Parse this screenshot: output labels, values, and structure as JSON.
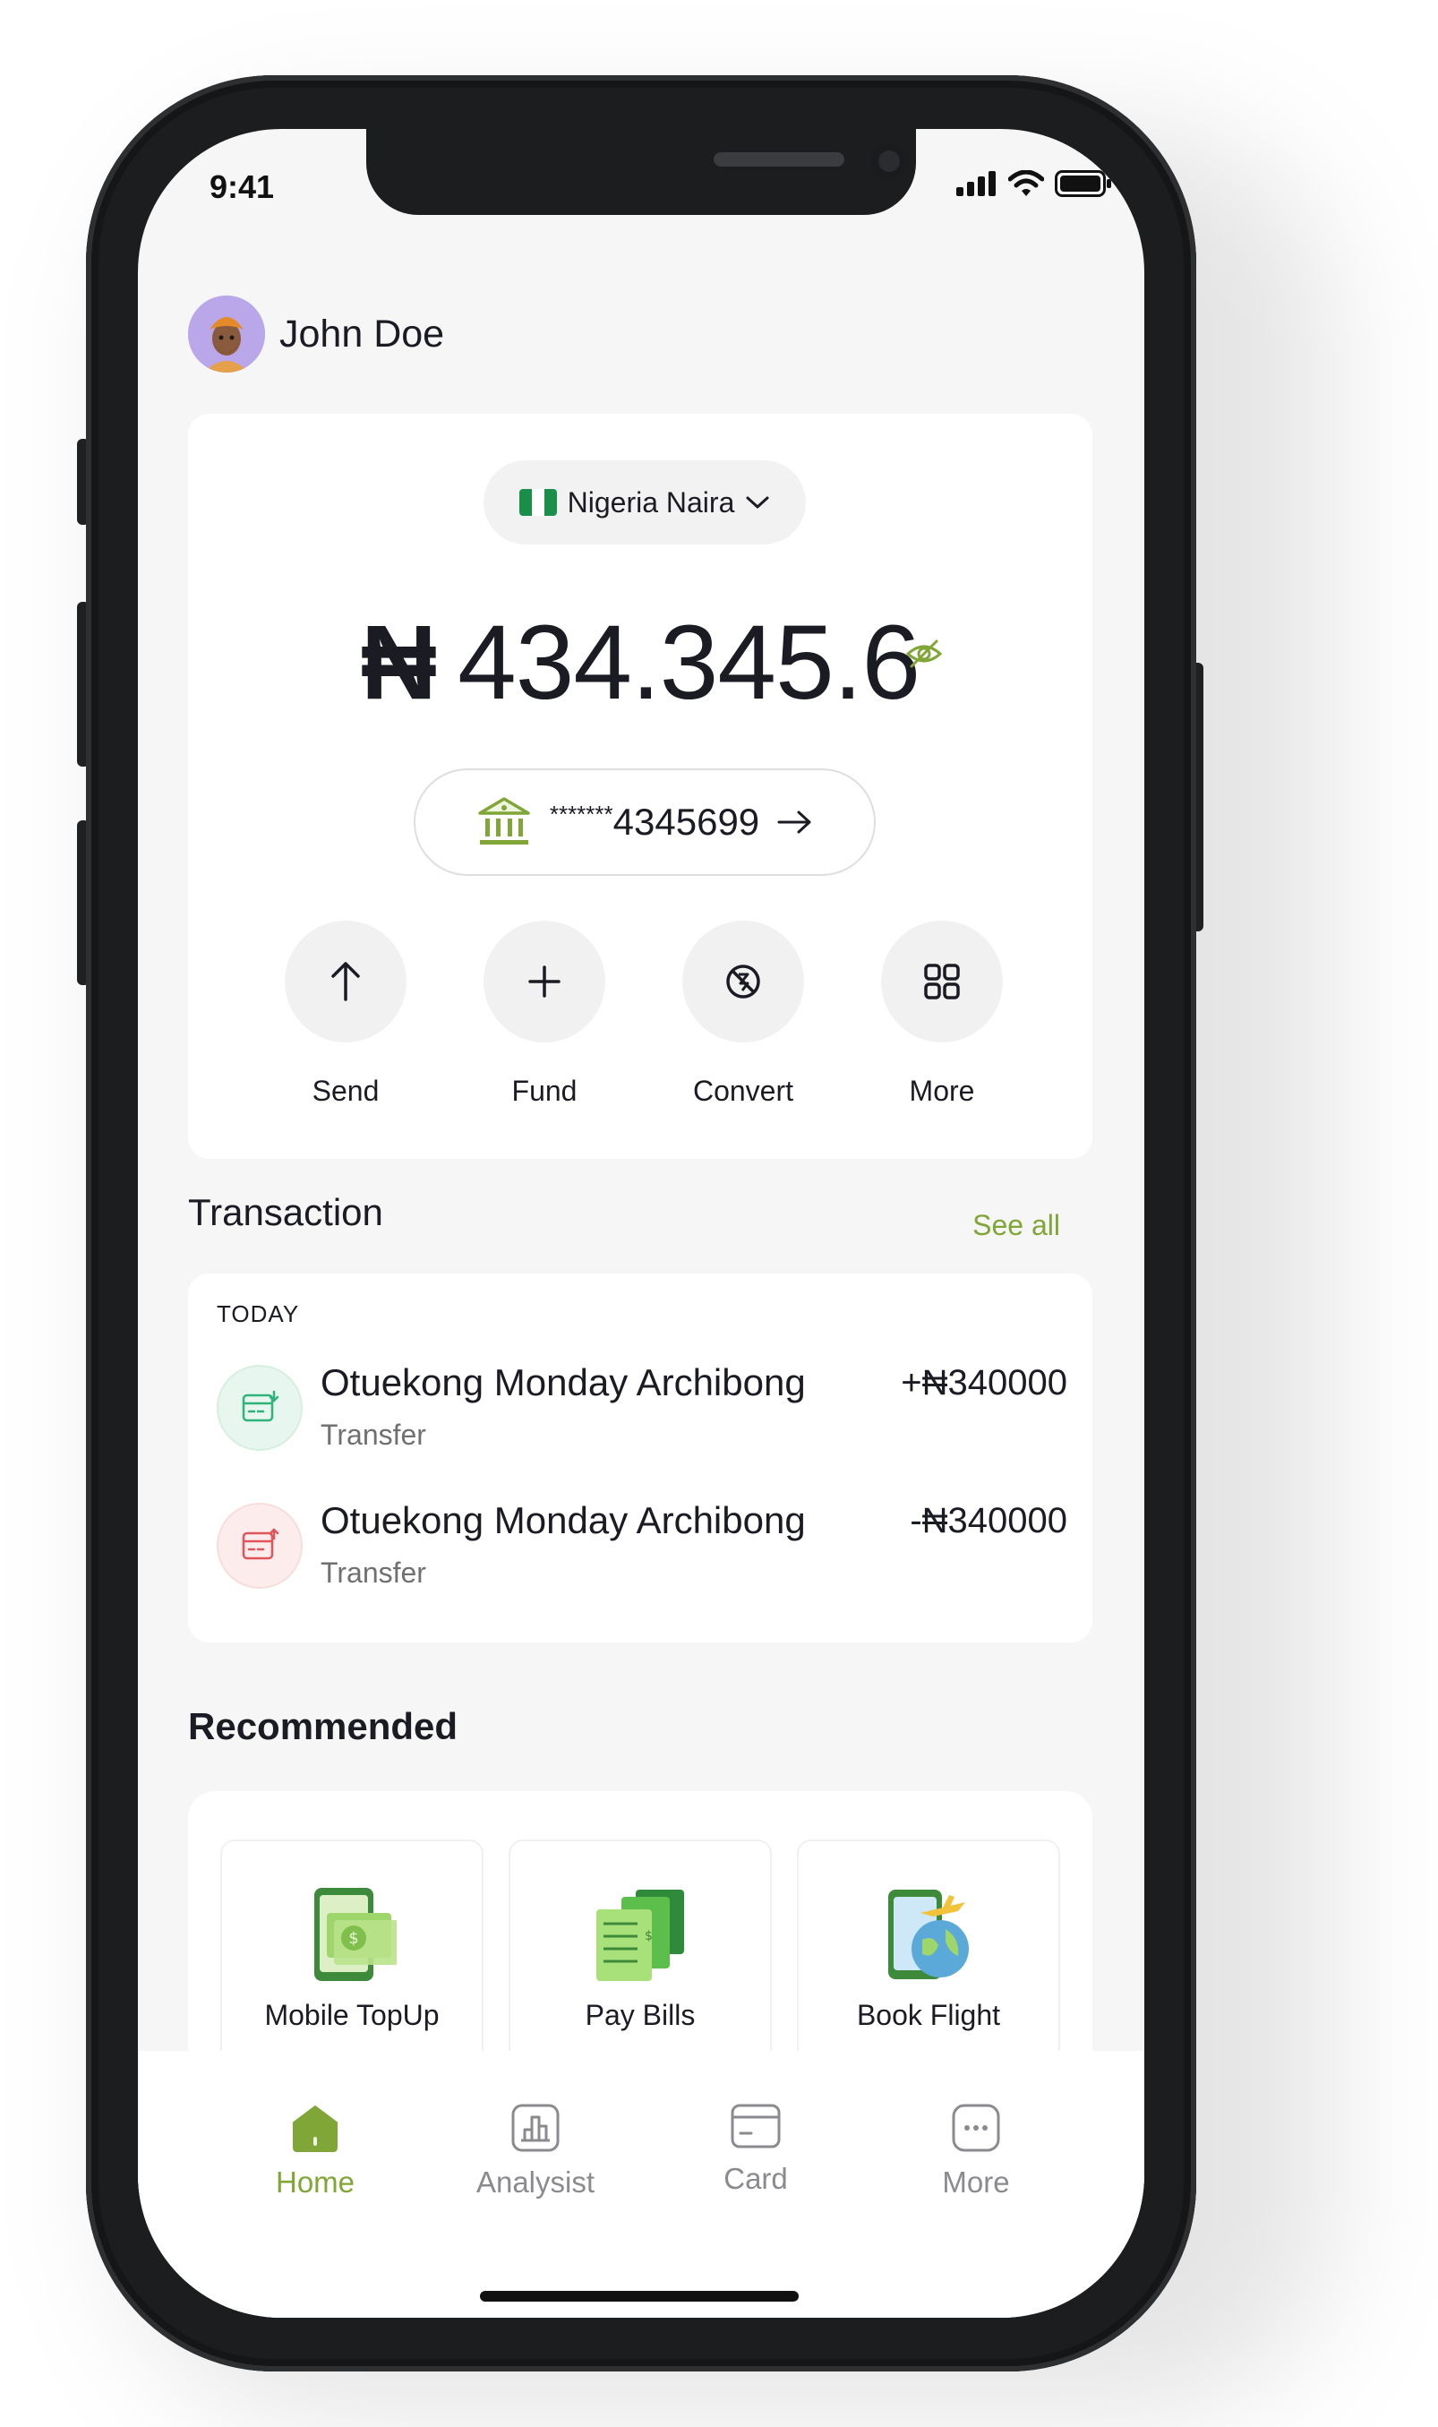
{
  "status_bar": {
    "time": "9:41"
  },
  "user": {
    "name": "John Doe"
  },
  "balance_card": {
    "currency_label": "Nigeria Naira",
    "currency_symbol": "₦",
    "balance": "434.345.6",
    "account_mask": "*******",
    "account_number": "4345699",
    "actions": [
      {
        "label": "Send",
        "icon": "arrow-up-icon"
      },
      {
        "label": "Fund",
        "icon": "plus-icon"
      },
      {
        "label": "Convert",
        "icon": "convert-icon"
      },
      {
        "label": "More",
        "icon": "grid-icon"
      }
    ]
  },
  "transactions": {
    "title": "Transaction",
    "see_all": "See all",
    "date_group": "TODAY",
    "items": [
      {
        "name": "Otuekong Monday Archibong",
        "type": "Transfer",
        "amount": "+₦340000",
        "direction": "in"
      },
      {
        "name": "Otuekong Monday Archibong",
        "type": "Transfer",
        "amount": "-₦340000",
        "direction": "out"
      }
    ]
  },
  "recommended": {
    "title": "Recommended",
    "items": [
      {
        "label": "Mobile TopUp",
        "icon": "mobile-topup-icon"
      },
      {
        "label": "Pay Bills",
        "icon": "pay-bills-icon"
      },
      {
        "label": "Book Flight",
        "icon": "book-flight-icon"
      }
    ]
  },
  "bottom_nav": {
    "items": [
      {
        "label": "Home",
        "icon": "home-icon",
        "active": true
      },
      {
        "label": "Analysist",
        "icon": "chart-icon",
        "active": false
      },
      {
        "label": "Card",
        "icon": "card-icon",
        "active": false
      },
      {
        "label": "More",
        "icon": "more-dots-icon",
        "active": false
      }
    ]
  },
  "colors": {
    "accent": "#7fa636",
    "income": "#2fb37a",
    "expense": "#e0555a",
    "text": "#1b1b24"
  }
}
